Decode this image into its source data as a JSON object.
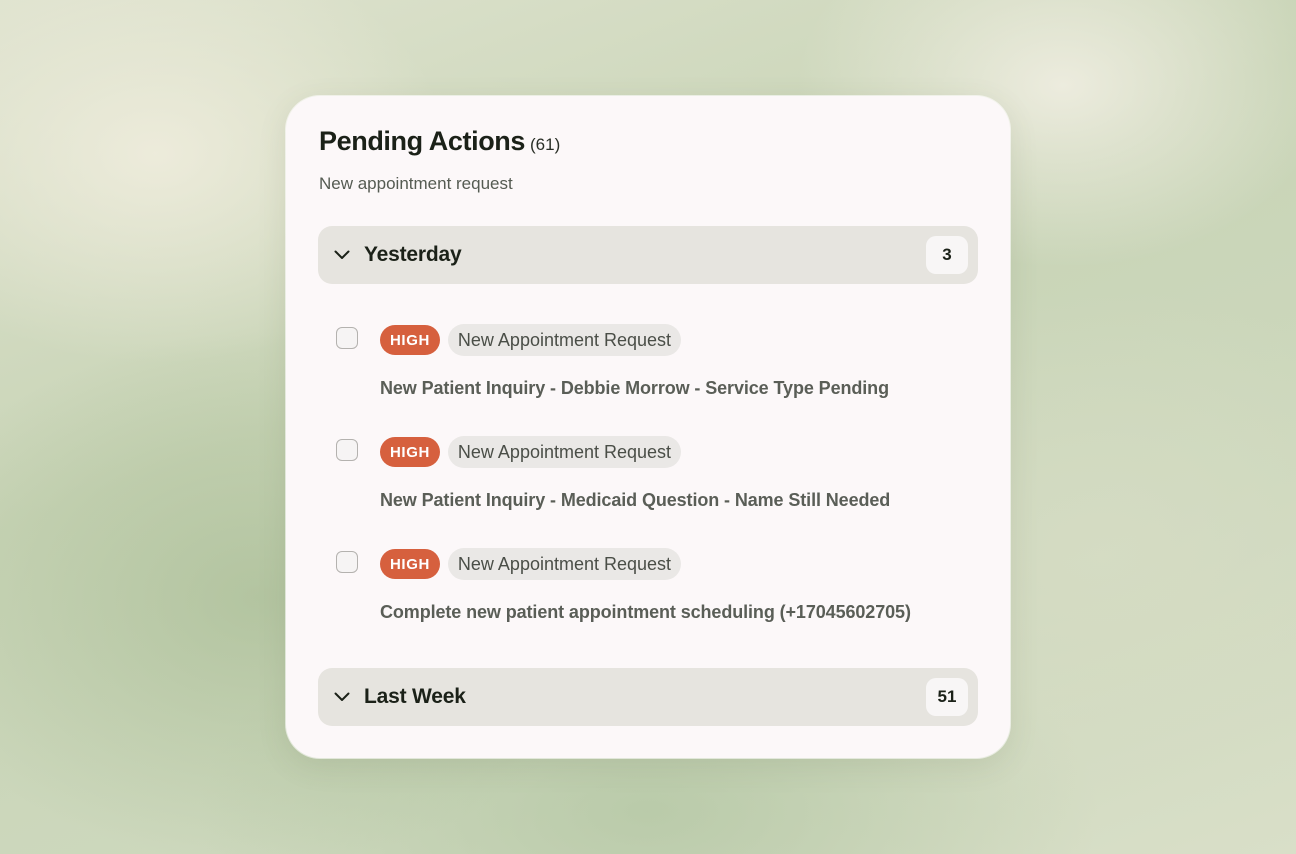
{
  "panel": {
    "title": "Pending Actions",
    "count": "(61)",
    "subtitle": "New appointment request"
  },
  "groups": [
    {
      "label": "Yesterday",
      "count": "3",
      "expanded": true,
      "items": [
        {
          "priority": "HIGH",
          "type": "New Appointment Request",
          "title": "New Patient Inquiry - Debbie Morrow - Service Type Pending",
          "checked": false
        },
        {
          "priority": "HIGH",
          "type": "New Appointment Request",
          "title": "New Patient Inquiry - Medicaid Question - Name Still Needed",
          "checked": false
        },
        {
          "priority": "HIGH",
          "type": "New Appointment Request",
          "title": "Complete new patient appointment scheduling (+17045602705)",
          "checked": false
        }
      ]
    },
    {
      "label": "Last Week",
      "count": "51",
      "expanded": false,
      "items": []
    }
  ],
  "colors": {
    "priority_high": "#d6603e",
    "card_background": "#fcf8f9",
    "group_header_background": "#e6e4df"
  },
  "icons": {
    "group_toggle": "chevron-down-icon"
  }
}
